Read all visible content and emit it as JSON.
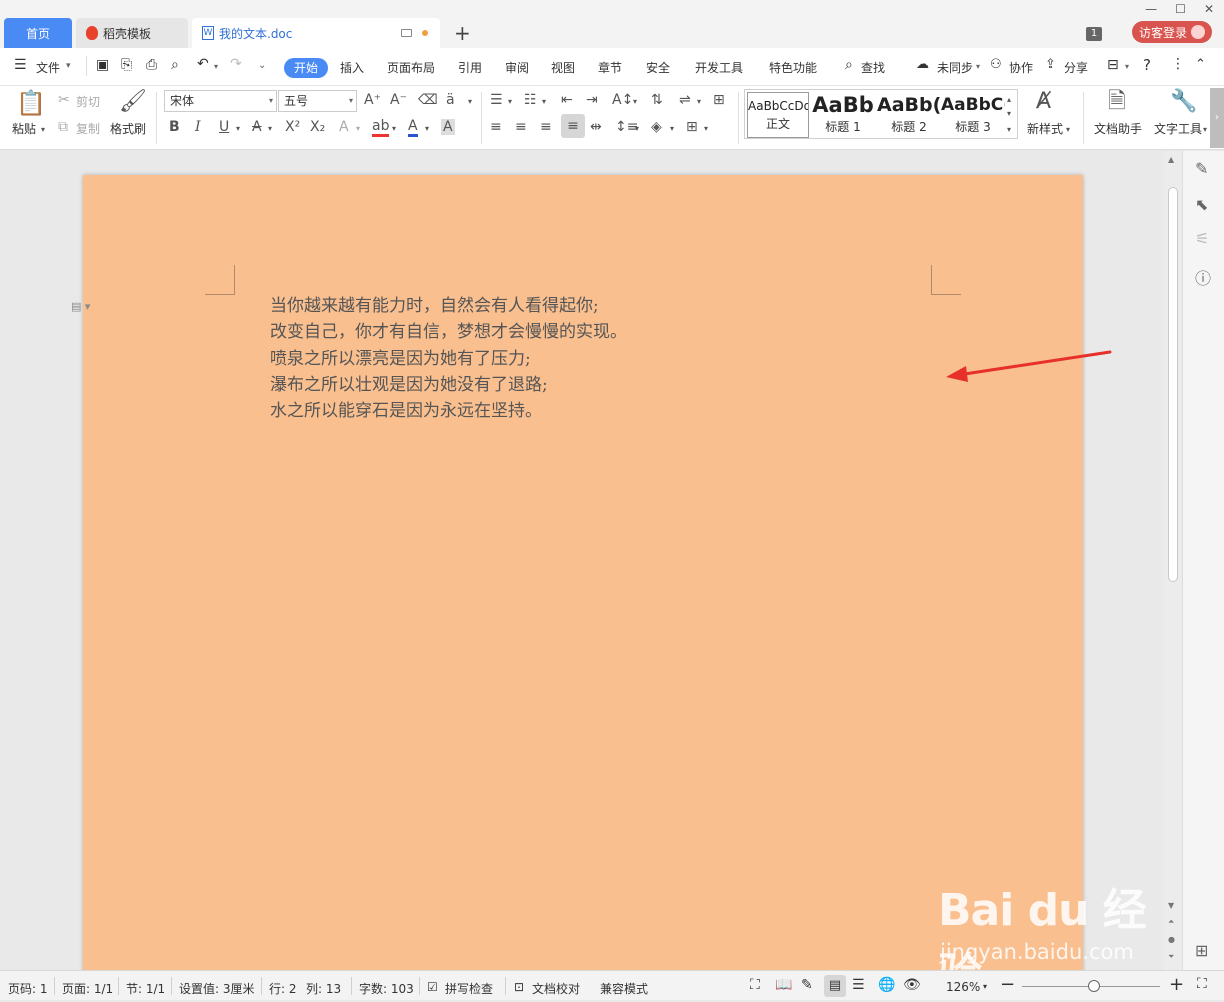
{
  "tabs": {
    "home": "首页",
    "template": "稻壳模板",
    "doc": "我的文本.doc",
    "badge": "1",
    "login": "访客登录"
  },
  "menu": {
    "file": "文件",
    "start": "开始",
    "items": [
      "插入",
      "页面布局",
      "引用",
      "审阅",
      "视图",
      "章节",
      "安全",
      "开发工具",
      "特色功能"
    ],
    "find": "查找",
    "sync": "未同步",
    "collab": "协作",
    "share": "分享"
  },
  "ribbon": {
    "paste": "粘贴",
    "cut": "剪切",
    "copy": "复制",
    "format_painter": "格式刷",
    "font_name": "宋体",
    "font_size": "五号",
    "styles": [
      {
        "sample": "AaBbCcDd",
        "label": "正文"
      },
      {
        "sample": "AaBb",
        "label": "标题 1"
      },
      {
        "sample": "AaBb(",
        "label": "标题 2"
      },
      {
        "sample": "AaBbC(",
        "label": "标题 3"
      }
    ],
    "new_style": "新样式",
    "doc_assistant": "文档助手",
    "text_tools": "文字工具"
  },
  "document": {
    "lines": [
      "当你越来越有能力时，自然会有人看得起你;",
      "改变自己，你才有自信，梦想才会慢慢的实现。",
      "喷泉之所以漂亮是因为她有了压力;",
      "瀑布之所以壮观是因为她没有了退路;",
      "水之所以能穿石是因为永远在坚持。"
    ],
    "page_color": "#f9bf8f"
  },
  "status": {
    "page_num": "页码: 1",
    "pages": "页面: 1/1",
    "section": "节: 1/1",
    "setting": "设置值: 3厘米",
    "row": "行: 2",
    "col": "列: 13",
    "word_count": "字数: 103",
    "spell_check": "拼写检查",
    "doc_proof": "文档校对",
    "compat_mode": "兼容模式",
    "zoom": "126%",
    "zoom_fraction": 0.52
  },
  "watermark": {
    "logo": "Bai du 经验",
    "url": "jingyan.baidu.com"
  },
  "colors": {
    "accent": "#4a8af4",
    "login": "#d9534f",
    "arrow": "#e8302a"
  }
}
